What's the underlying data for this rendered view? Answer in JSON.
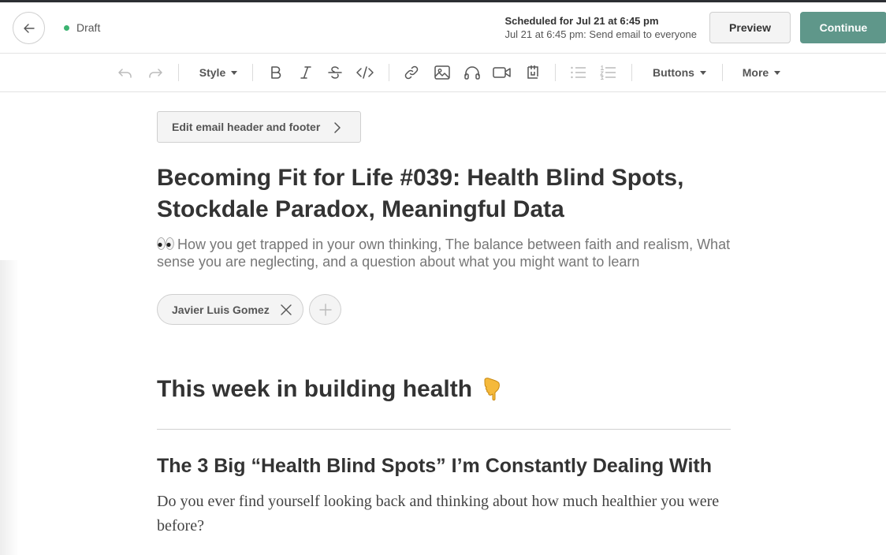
{
  "header": {
    "status": "Draft",
    "schedule_title": "Scheduled for Jul 21 at 6:45 pm",
    "schedule_detail": "Jul 21 at 6:45 pm: Send email to everyone",
    "preview_label": "Preview",
    "continue_label": "Continue"
  },
  "toolbar": {
    "style_label": "Style",
    "buttons_label": "Buttons",
    "more_label": "More",
    "icons": [
      "undo-icon",
      "redo-icon",
      "bold-icon",
      "italic-icon",
      "strikethrough-icon",
      "code-icon",
      "link-icon",
      "image-icon",
      "audio-icon",
      "video-icon",
      "embed-icon",
      "bullet-list-icon",
      "numbered-list-icon"
    ]
  },
  "content": {
    "edit_header_footer_label": "Edit email header and footer",
    "title": "Becoming Fit for Life #039: Health Blind Spots, Stockdale Paradox, Meaningful Data",
    "subtitle": "How you get trapped in your own thinking, The balance between faith and realism, What sense you are neglecting, and a question about what you might want to learn",
    "author": "Javier Luis Gomez",
    "section_heading": "This week in building health",
    "article_heading": "The 3 Big “Health Blind Spots” I’m Constantly Dealing With",
    "paragraph": "Do you ever find yourself looking back and thinking about how much healthier you were before?"
  },
  "colors": {
    "accent": "#5f978a",
    "status_dot": "#3cb371"
  }
}
